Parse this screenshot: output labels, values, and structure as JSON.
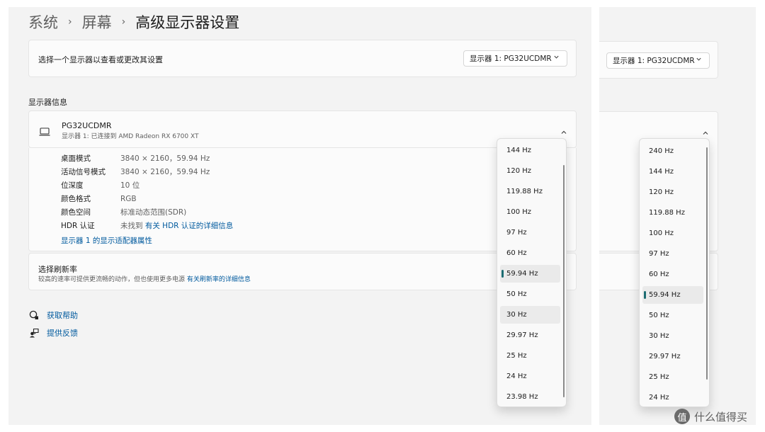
{
  "breadcrumb": {
    "items": [
      "系统",
      "屏幕",
      "高级显示器设置"
    ],
    "separator": "›"
  },
  "select_display": {
    "label": "选择一个显示器以查看或更改其设置",
    "dropdown_value": "显示器 1: PG32UCDMR"
  },
  "display_info": {
    "section_label": "显示器信息",
    "monitor_name": "PG32UCDMR",
    "monitor_sub": "显示器 1: 已连接到 AMD Radeon RX 6700 XT",
    "rows": [
      {
        "label": "桌面模式",
        "value": "3840 × 2160，59.94 Hz"
      },
      {
        "label": "活动信号模式",
        "value": "3840 × 2160，59.94 Hz"
      },
      {
        "label": "位深度",
        "value": "10 位"
      },
      {
        "label": "颜色格式",
        "value": "RGB"
      },
      {
        "label": "颜色空间",
        "value": "标准动态范围(SDR)"
      },
      {
        "label": "HDR 认证",
        "value": "未找到",
        "link": "有关 HDR 认证的详细信息"
      }
    ],
    "adapter_link": "显示器 1 的显示适配器属性"
  },
  "refresh": {
    "title": "选择刷新率",
    "desc": "较高的速率可提供更流畅的动作，但也使用更多电源",
    "link": "有关刷新率的详细信息"
  },
  "help": {
    "get_help": "获取帮助",
    "feedback": "提供反馈"
  },
  "menu_left": {
    "items": [
      "144 Hz",
      "120 Hz",
      "119.88 Hz",
      "100 Hz",
      "97 Hz",
      "60 Hz",
      "59.94 Hz",
      "50 Hz",
      "30 Hz",
      "29.97 Hz",
      "25 Hz",
      "24 Hz",
      "23.98 Hz"
    ],
    "selected": "59.94 Hz",
    "hover": "30 Hz"
  },
  "menu_right": {
    "items": [
      "240 Hz",
      "144 Hz",
      "120 Hz",
      "119.88 Hz",
      "100 Hz",
      "97 Hz",
      "60 Hz",
      "59.94 Hz",
      "50 Hz",
      "30 Hz",
      "29.97 Hz",
      "25 Hz",
      "24 Hz"
    ],
    "selected": "59.94 Hz"
  },
  "right_pane": {
    "dropdown_value": "显示器 1: PG32UCDMR"
  },
  "watermark": {
    "icon_char": "值",
    "text": "什么值得买"
  },
  "colors": {
    "accent": "#1c6c72",
    "link": "#005a9e",
    "background": "#f3f3f3",
    "card": "#fbfbfb"
  },
  "icons": [
    "chevron-down-icon",
    "chevron-up-icon",
    "laptop-icon",
    "help-icon",
    "feedback-icon"
  ]
}
